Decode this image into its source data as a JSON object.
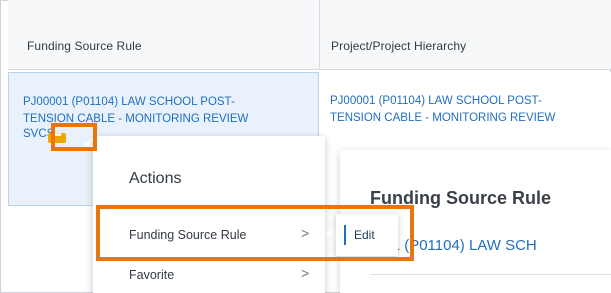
{
  "grid": {
    "columns": [
      {
        "header": "Funding Source Rule"
      },
      {
        "header": "Project/Project Hierarchy"
      }
    ],
    "row": {
      "funding_source_rule_line1": "PJ00001 (P01104) LAW SCHOOL POST-",
      "funding_source_rule_line2": "TENSION CABLE - MONITORING REVIEW",
      "funding_source_rule_line3": "SVCS",
      "project_line1": "PJ00001 (P01104) LAW SCHOOL POST-",
      "project_line2": "TENSION CABLE - MONITORING REVIEW",
      "related_actions_label": "•••"
    }
  },
  "actions_popup": {
    "title": "Actions",
    "items": [
      {
        "label": "Funding Source Rule",
        "chevron": ">"
      },
      {
        "label": "Favorite",
        "chevron": ">"
      }
    ]
  },
  "submenu": {
    "edit_label": "Edit"
  },
  "detail_panel": {
    "title": "Funding Source Rule",
    "subtitle": "001 (P01104) LAW SCH"
  },
  "colors": {
    "highlight": "#e8760c",
    "link": "#1f6fbf",
    "related_action_button": "#f0a500",
    "selected_cell": "#e9f2fc"
  }
}
